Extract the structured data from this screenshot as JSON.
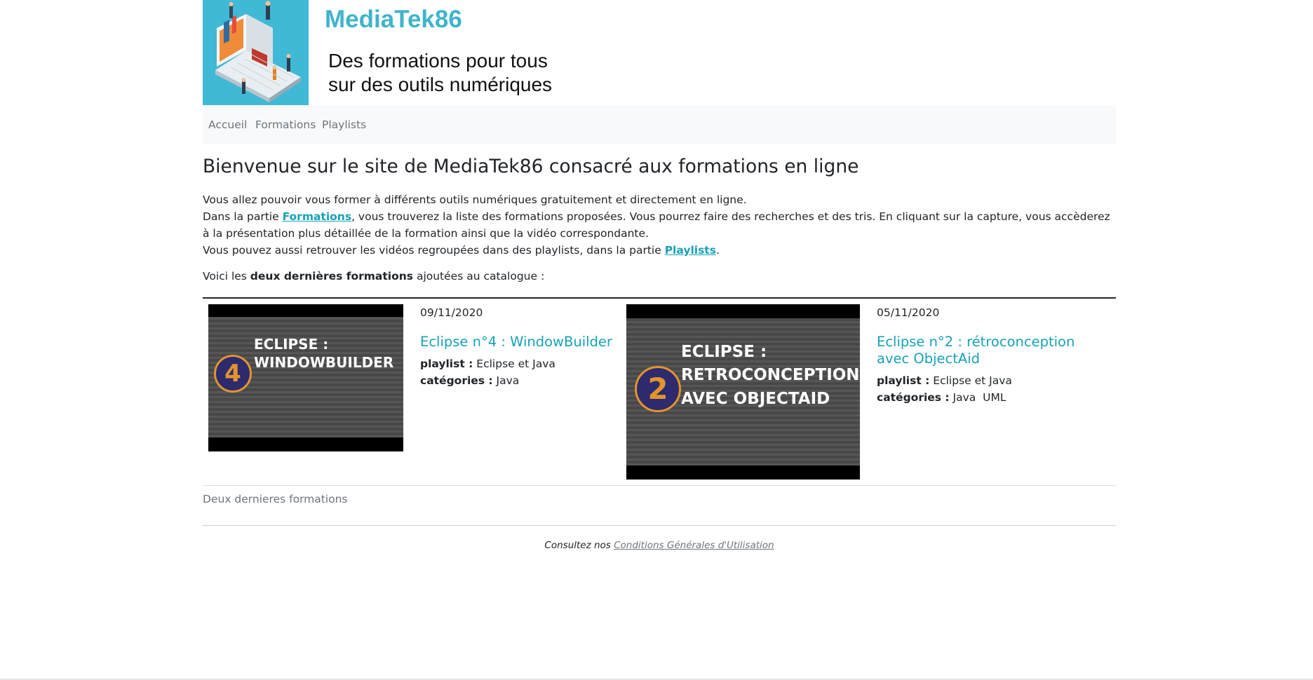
{
  "header": {
    "site_name": "MediaTek86",
    "slogan_line1": "Des formations pour tous",
    "slogan_line2": "sur des outils numériques"
  },
  "nav": {
    "items": [
      {
        "label": "Accueil"
      },
      {
        "label": "Formations"
      },
      {
        "label": "Playlists"
      }
    ]
  },
  "main": {
    "title": "Bienvenue sur le site de MediaTek86 consacré aux formations en ligne",
    "intro_line1": "Vous allez pouvoir vous former à différents outils numériques gratuitement et directement en ligne.",
    "intro_line2_before": "Dans la partie ",
    "intro_line2_link": "Formations",
    "intro_line2_after": ", vous trouverez la liste des formations proposées. Vous pourrez faire des recherches et des tris. En cliquant sur la capture, vous accèderez à la présentation plus détaillée de la formation ainsi que la vidéo correspondante.",
    "intro_line3_before": "Vous pouvez aussi retrouver les vidéos regroupées dans des playlists, dans la partie ",
    "intro_line3_link": "Playlists",
    "intro_line3_after": ".",
    "latest_before": "Voici les ",
    "latest_bold": "deux dernières formations",
    "latest_after": " ajoutées au catalogue :"
  },
  "formations": [
    {
      "date": "09/11/2020",
      "title": "Eclipse n°4 : WindowBuilder",
      "playlist_label": "playlist :",
      "playlist": "Eclipse et Java",
      "categories_label": "catégories :",
      "categories": "Java",
      "thumb_number": "4",
      "thumb_line1": "ECLIPSE :",
      "thumb_line2": "WINDOWBUILDER"
    },
    {
      "date": "05/11/2020",
      "title": "Eclipse n°2 : rétroconception avec ObjectAid",
      "playlist_label": "playlist :",
      "playlist": "Eclipse et Java",
      "categories_label": "catégories :",
      "categories": "Java  UML",
      "thumb_number": "2",
      "thumb_line1": "ECLIPSE :",
      "thumb_line2": "RETROCONCEPTION",
      "thumb_line3": "AVEC OBJECTAID"
    }
  ],
  "table_caption": "Deux dernieres formations",
  "footer": {
    "text": "Consultez nos ",
    "link": "Conditions Générales d'Utilisation"
  },
  "colors": {
    "brand": "#40b4cc",
    "link": "#17a2b8",
    "logo_bg": "#40b9d6",
    "navbar_bg": "#f8f9fa"
  }
}
